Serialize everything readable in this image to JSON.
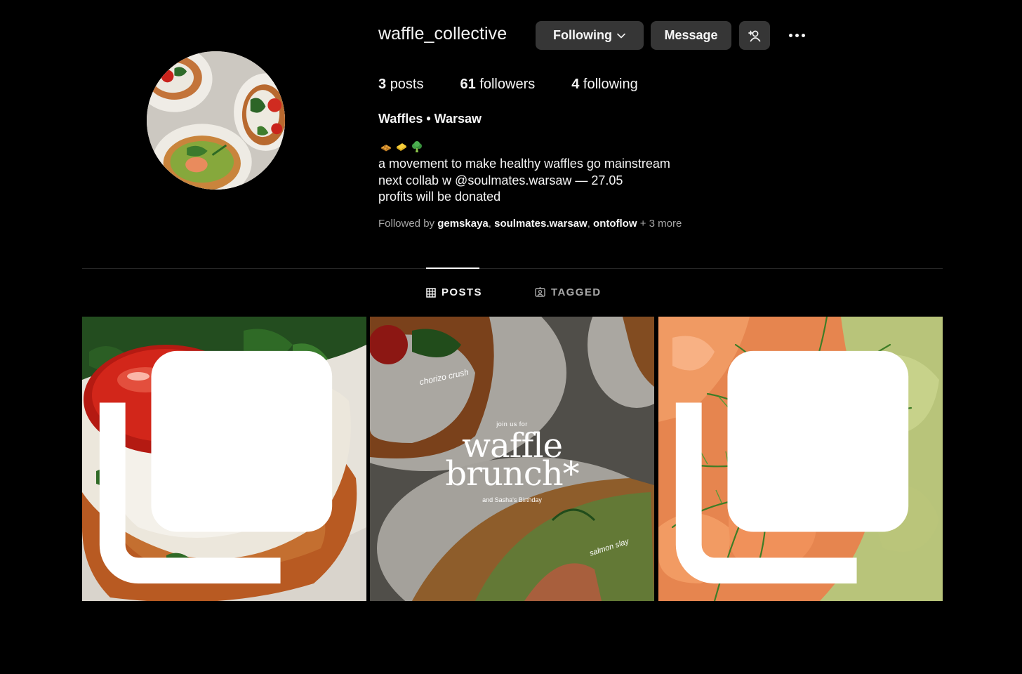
{
  "profile": {
    "username": "waffle_collective",
    "following_button": "Following",
    "message_button": "Message",
    "posts_count": "3",
    "posts_label": "posts",
    "followers_count": "61",
    "followers_label": "followers",
    "following_count": "4",
    "following_label": "following"
  },
  "bio": {
    "name": "Waffles • Warsaw",
    "emoji": [
      "waffle-emoji",
      "butter-emoji",
      "broccoli-emoji"
    ],
    "line1": "a movement to make healthy waffles go mainstream",
    "line2": "next collab w @soulmates.warsaw — 27.05",
    "line3": "profits will be donated"
  },
  "followed_by": {
    "prefix": "Followed by",
    "users": [
      "gemskaya",
      "soulmates.warsaw",
      "ontoflow"
    ],
    "more": "+ 3 more"
  },
  "tabs": {
    "posts": "POSTS",
    "tagged": "TAGGED",
    "active": "posts"
  },
  "posts": [
    {
      "multi": true
    },
    {
      "multi": false,
      "join": "join us for",
      "title1": "waffle",
      "title2": "brunch*",
      "subtitle": "and Sasha's Birthday",
      "note1": "chorizo crush",
      "note2": "salmon slay"
    },
    {
      "multi": true
    }
  ],
  "colors": {
    "background": "#000000",
    "button": "#363636",
    "text": "#f5f5f5",
    "muted": "#a8a8a8",
    "divider": "#262626"
  }
}
